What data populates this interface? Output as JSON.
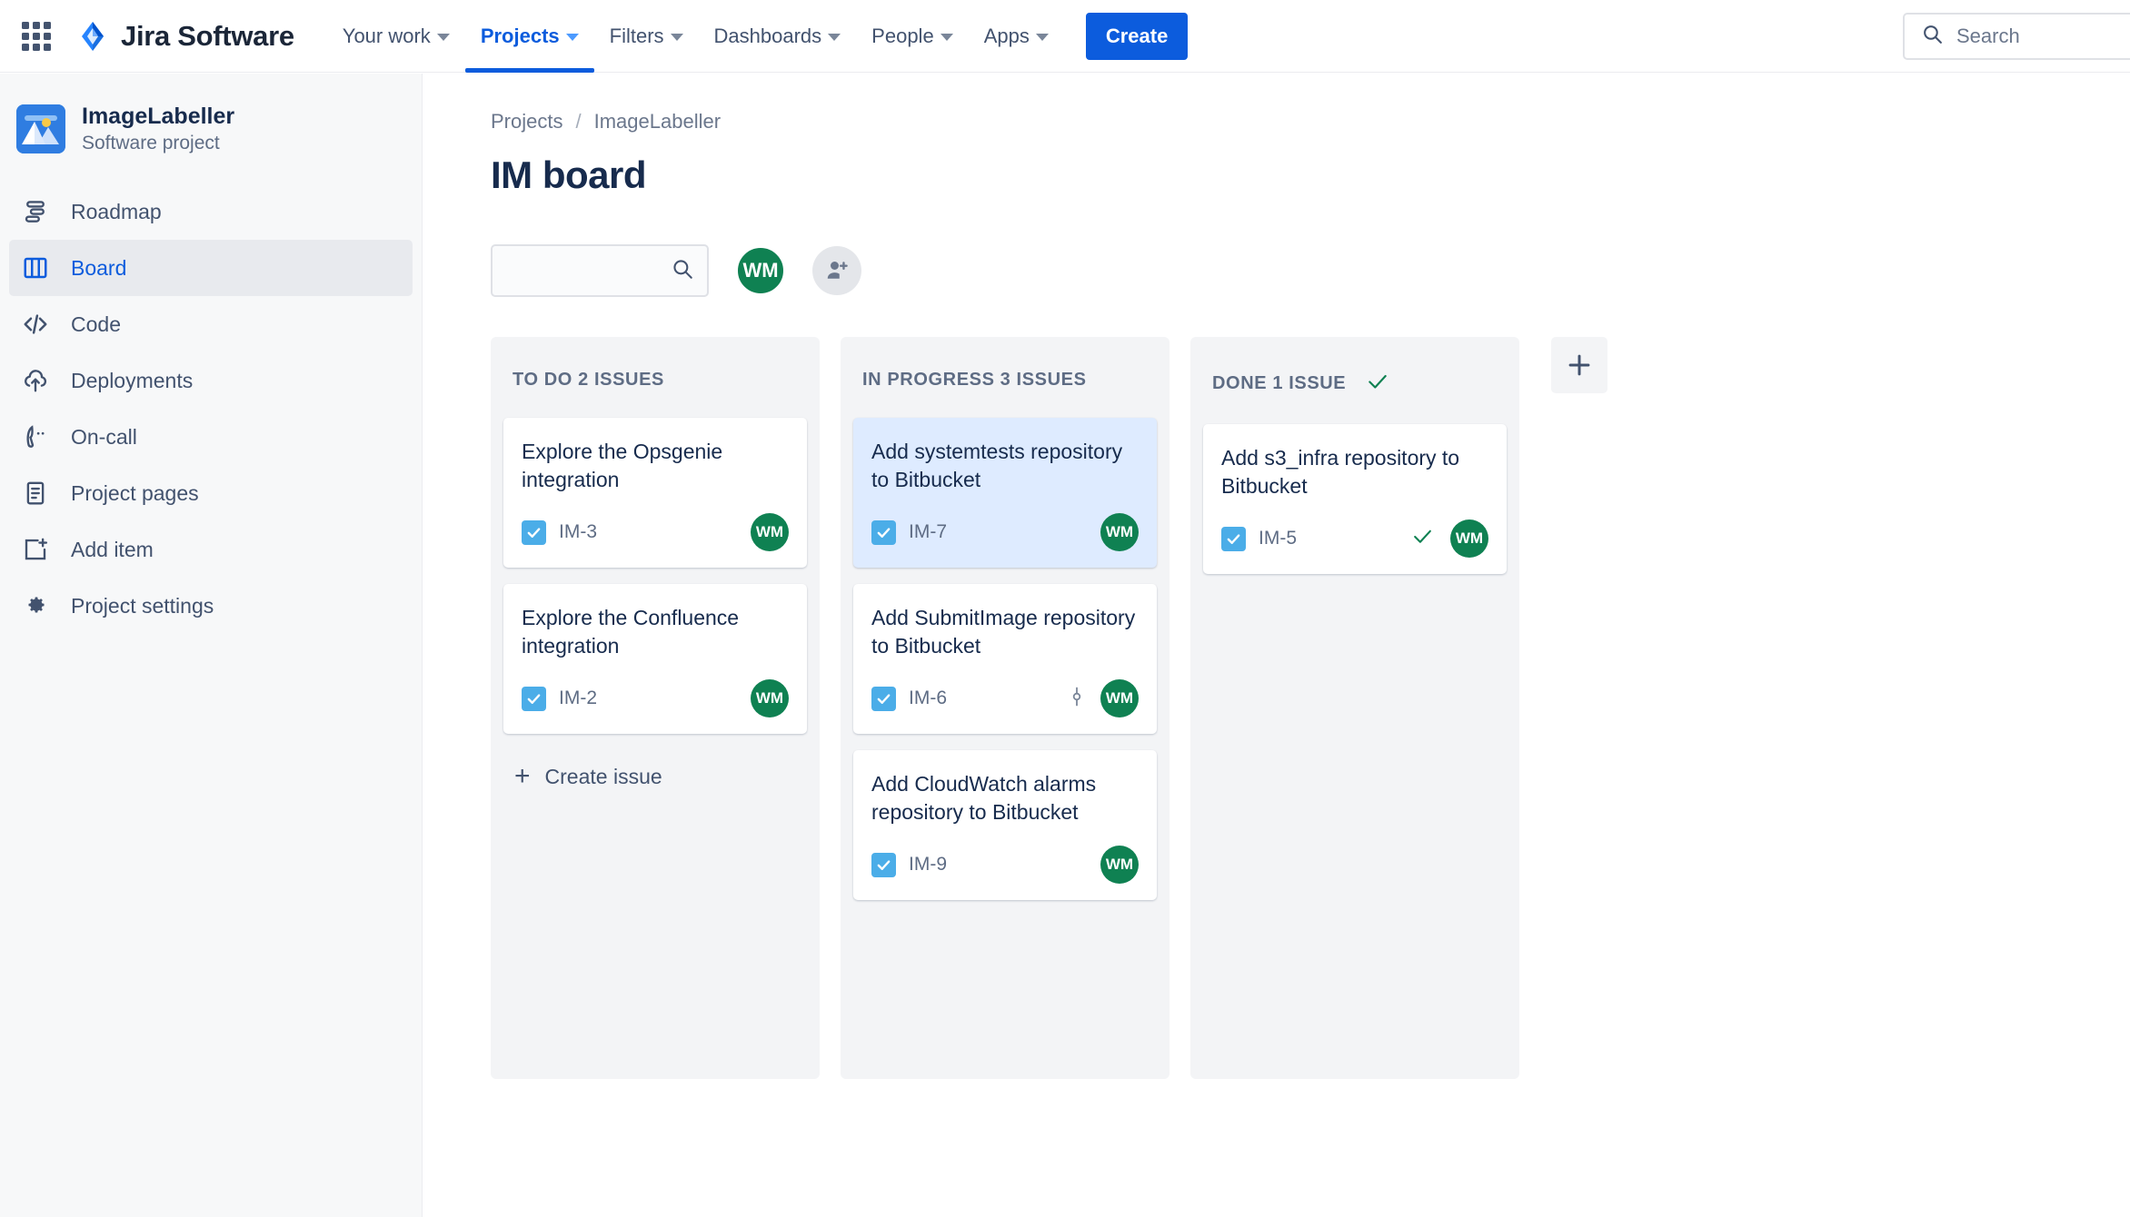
{
  "topnav": {
    "brand": "Jira Software",
    "items": [
      {
        "label": "Your work",
        "active": false
      },
      {
        "label": "Projects",
        "active": true
      },
      {
        "label": "Filters",
        "active": false
      },
      {
        "label": "Dashboards",
        "active": false
      },
      {
        "label": "People",
        "active": false
      },
      {
        "label": "Apps",
        "active": false
      }
    ],
    "create_label": "Create",
    "search_placeholder": "Search",
    "search_value": ""
  },
  "sidebar": {
    "project_name": "ImageLabeller",
    "project_type": "Software project",
    "items": [
      {
        "label": "Roadmap",
        "icon": "roadmap-icon",
        "active": false
      },
      {
        "label": "Board",
        "icon": "board-icon",
        "active": true
      },
      {
        "label": "Code",
        "icon": "code-icon",
        "active": false
      },
      {
        "label": "Deployments",
        "icon": "deployments-icon",
        "active": false
      },
      {
        "label": "On-call",
        "icon": "on-call-icon",
        "active": false
      },
      {
        "label": "Project pages",
        "icon": "project-pages-icon",
        "active": false
      },
      {
        "label": "Add item",
        "icon": "add-item-icon",
        "active": false
      },
      {
        "label": "Project settings",
        "icon": "gear-icon",
        "active": false
      }
    ]
  },
  "main": {
    "breadcrumb": [
      {
        "label": "Projects"
      },
      {
        "label": "ImageLabeller"
      }
    ],
    "breadcrumb_separator": "/",
    "title": "IM board",
    "filter_placeholder": "",
    "filter_value": "",
    "member_avatar": "WM",
    "create_issue_label": "Create issue"
  },
  "colors": {
    "brand_blue": "#0c5cdd",
    "avatar_green": "#0f8152",
    "task_icon_blue": "#4bade8",
    "selected_card": "#deebff",
    "column_bg": "#f3f4f6",
    "done_check": "#0f8152"
  },
  "board": {
    "columns": [
      {
        "title": "TO DO 2 ISSUES",
        "has_done_check": false,
        "show_create_issue": true,
        "cards": [
          {
            "title": "Explore the Opsgenie integration",
            "key": "IM-3",
            "type": "task",
            "avatar": "WM",
            "selected": false,
            "has_branch_icon": false,
            "has_done_check": false
          },
          {
            "title": "Explore the Confluence integration",
            "key": "IM-2",
            "type": "task",
            "avatar": "WM",
            "selected": false,
            "has_branch_icon": false,
            "has_done_check": false
          }
        ]
      },
      {
        "title": "IN PROGRESS 3 ISSUES",
        "has_done_check": false,
        "show_create_issue": false,
        "cards": [
          {
            "title": "Add systemtests repository to Bitbucket",
            "key": "IM-7",
            "type": "task",
            "avatar": "WM",
            "selected": true,
            "has_branch_icon": false,
            "has_done_check": false
          },
          {
            "title": "Add SubmitImage repository to Bitbucket",
            "key": "IM-6",
            "type": "task",
            "avatar": "WM",
            "selected": false,
            "has_branch_icon": true,
            "has_done_check": false
          },
          {
            "title": "Add CloudWatch alarms repository to Bitbucket",
            "key": "IM-9",
            "type": "task",
            "avatar": "WM",
            "selected": false,
            "has_branch_icon": false,
            "has_done_check": false
          }
        ]
      },
      {
        "title": "DONE 1 ISSUE",
        "has_done_check": true,
        "show_create_issue": false,
        "cards": [
          {
            "title": "Add s3_infra repository to Bitbucket",
            "key": "IM-5",
            "type": "task",
            "avatar": "WM",
            "selected": false,
            "has_branch_icon": false,
            "has_done_check": true
          }
        ]
      }
    ],
    "add_column_label": "+"
  }
}
